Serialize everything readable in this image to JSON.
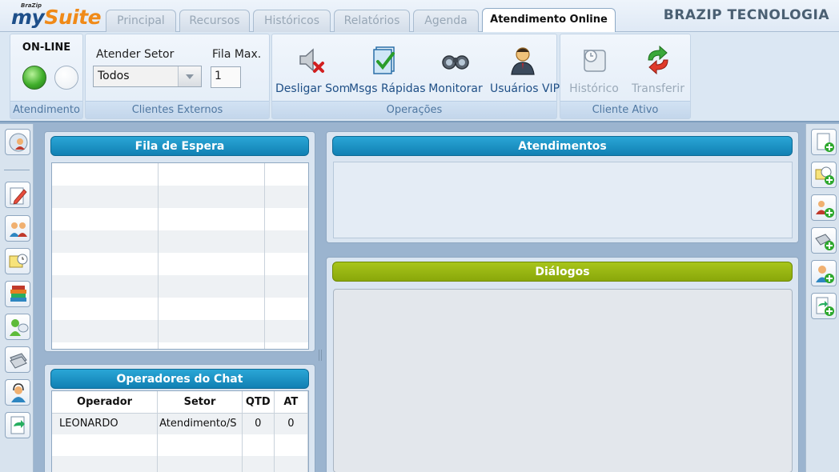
{
  "app": {
    "logo_small": "BraZip",
    "logo_my": "my",
    "logo_suite": "Suite",
    "company": "BRAZIP TECNOLOGIA"
  },
  "tabs": [
    {
      "label": "Principal"
    },
    {
      "label": "Recursos"
    },
    {
      "label": "Históricos"
    },
    {
      "label": "Relatórios"
    },
    {
      "label": "Agenda"
    },
    {
      "label": "Atendimento Online",
      "active": true
    }
  ],
  "ribbon": {
    "atendimento": {
      "status_label": "ON-LINE",
      "group_label": "Atendimento",
      "online_color": "#3fae2a"
    },
    "clientes_externos": {
      "setor_label": "Atender Setor",
      "setor_value": "Todos",
      "fila_label": "Fila Max.",
      "fila_value": "1",
      "group_label": "Clientes Externos"
    },
    "operacoes": {
      "group_label": "Operações",
      "buttons": [
        {
          "label": "Desligar Som",
          "icon": "speaker-mute-icon"
        },
        {
          "label": "Msgs Rápidas",
          "icon": "quick-messages-icon"
        },
        {
          "label": "Monitorar",
          "icon": "binoculars-icon"
        },
        {
          "label": "Usuários VIP",
          "icon": "vip-user-icon"
        }
      ]
    },
    "cliente_ativo": {
      "group_label": "Cliente Ativo",
      "buttons": [
        {
          "label": "Histórico",
          "icon": "history-scroll-icon",
          "disabled": true
        },
        {
          "label": "Transferir",
          "icon": "transfer-arrows-icon",
          "disabled": true
        }
      ]
    }
  },
  "panels": {
    "fila": {
      "title": "Fila de Espera"
    },
    "operadores": {
      "title": "Operadores do Chat",
      "columns": [
        "Operador",
        "Setor",
        "QTD",
        "AT"
      ],
      "rows": [
        {
          "operador": "LEONARDO",
          "setor": "Atendimento/S",
          "qtd": "0",
          "at": "0"
        }
      ]
    },
    "atendimentos": {
      "title": "Atendimentos"
    },
    "dialogos": {
      "title": "Diálogos"
    }
  },
  "colors": {
    "header_blue": "#1a93c6",
    "header_green": "#95b311",
    "logo_blue": "#1d4f8a",
    "logo_orange": "#f08a18"
  }
}
